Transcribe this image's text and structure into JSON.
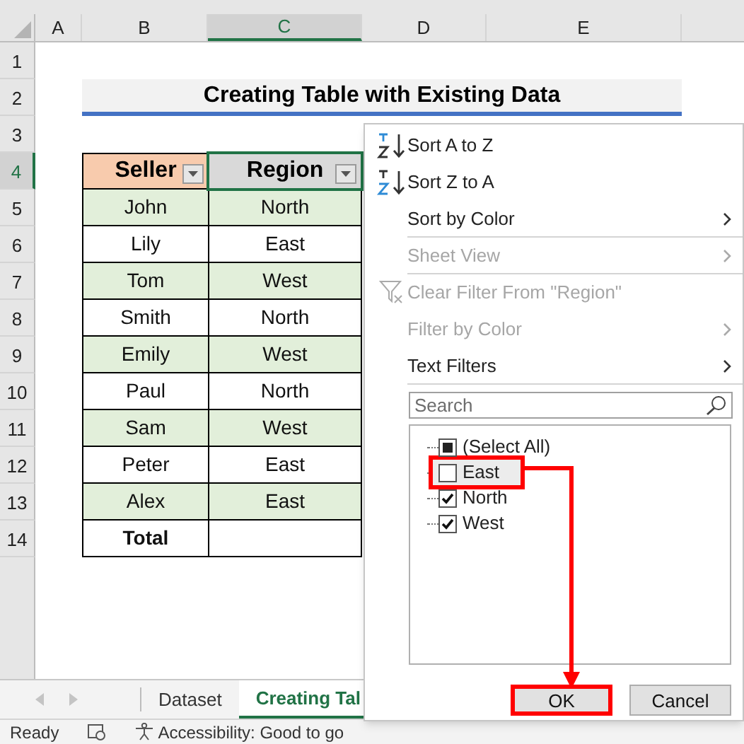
{
  "columns": [
    {
      "label": "A",
      "selected": false
    },
    {
      "label": "B",
      "selected": false
    },
    {
      "label": "C",
      "selected": true
    },
    {
      "label": "D",
      "selected": false
    },
    {
      "label": "E",
      "selected": false
    }
  ],
  "row_numbers": [
    {
      "label": "1",
      "selected": false
    },
    {
      "label": "2",
      "selected": false
    },
    {
      "label": "3",
      "selected": false
    },
    {
      "label": "4",
      "selected": true
    },
    {
      "label": "5",
      "selected": false
    },
    {
      "label": "6",
      "selected": false
    },
    {
      "label": "7",
      "selected": false
    },
    {
      "label": "8",
      "selected": false
    },
    {
      "label": "9",
      "selected": false
    },
    {
      "label": "10",
      "selected": false
    },
    {
      "label": "11",
      "selected": false
    },
    {
      "label": "12",
      "selected": false
    },
    {
      "label": "13",
      "selected": false
    },
    {
      "label": "14",
      "selected": false
    }
  ],
  "title": "Creating Table with Existing Data",
  "table": {
    "headers": [
      "Seller",
      "Region"
    ],
    "rows": [
      [
        "John",
        "North"
      ],
      [
        "Lily",
        "East"
      ],
      [
        "Tom",
        "West"
      ],
      [
        "Smith",
        "North"
      ],
      [
        "Emily",
        "West"
      ],
      [
        "Paul",
        "North"
      ],
      [
        "Sam",
        "West"
      ],
      [
        "Peter",
        "East"
      ],
      [
        "Alex",
        "East"
      ]
    ],
    "total": "Total"
  },
  "filter_menu": {
    "items": [
      {
        "kind": "ascending",
        "label": "Sort A to Z",
        "disabled": false,
        "submenu": false,
        "divider": false
      },
      {
        "kind": "descending",
        "label": "Sort Z to A",
        "disabled": false,
        "submenu": false,
        "divider": false
      },
      {
        "kind": "plain",
        "label": "Sort by Color",
        "disabled": false,
        "submenu": true,
        "divider": true
      },
      {
        "kind": "plain",
        "label": "Sheet View",
        "disabled": true,
        "submenu": true,
        "divider": true
      },
      {
        "kind": "clear",
        "label": "Clear Filter From \"Region\"",
        "disabled": true,
        "submenu": false,
        "divider": false
      },
      {
        "kind": "plain",
        "label": "Filter by Color",
        "disabled": true,
        "submenu": true,
        "divider": false
      },
      {
        "kind": "plain",
        "label": "Text Filters",
        "disabled": false,
        "submenu": true,
        "divider": true
      }
    ],
    "search": {
      "placeholder": "Search"
    },
    "options": [
      {
        "label": "(Select All)",
        "checked": false,
        "partial": true,
        "hovered": false,
        "callout": false
      },
      {
        "label": "East",
        "checked": false,
        "partial": false,
        "hovered": true,
        "callout": true
      },
      {
        "label": "North",
        "checked": true,
        "partial": false,
        "hovered": false,
        "callout": false
      },
      {
        "label": "West",
        "checked": true,
        "partial": false,
        "hovered": false,
        "callout": false
      }
    ],
    "buttons": [
      {
        "label": "OK",
        "callout": true
      },
      {
        "label": "Cancel",
        "callout": false
      }
    ]
  },
  "sheet_tabs": [
    {
      "label": "Dataset",
      "selected": false
    },
    {
      "label": "Creating Tal",
      "selected": true
    }
  ],
  "status_bar": {
    "mode": "Ready",
    "accessibility": "Accessibility: Good to go"
  }
}
